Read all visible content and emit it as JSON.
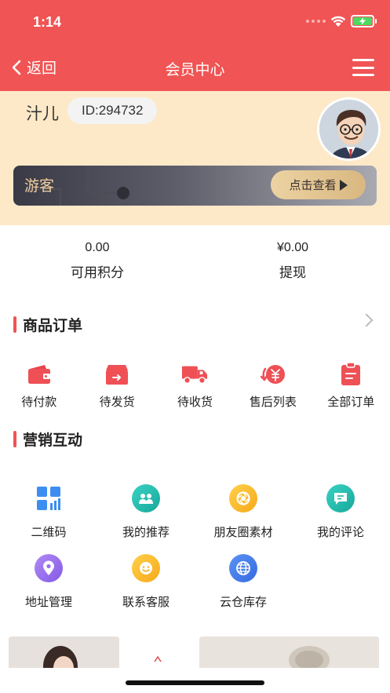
{
  "status": {
    "time": "1:14"
  },
  "nav": {
    "back_label": "返回",
    "title": "会员中心"
  },
  "profile": {
    "name": "汁儿",
    "id": "ID:294732"
  },
  "vip": {
    "level": "游客",
    "button": "点击查看"
  },
  "stats": [
    {
      "value": "0.00",
      "label": "可用积分"
    },
    {
      "value": "¥0.00",
      "label": "提现"
    }
  ],
  "orders": {
    "title": "商品订单",
    "items": [
      {
        "label": "待付款",
        "icon": "wallet-icon"
      },
      {
        "label": "待发货",
        "icon": "box-icon"
      },
      {
        "label": "待收货",
        "icon": "truck-icon"
      },
      {
        "label": "售后列表",
        "icon": "refund-icon"
      },
      {
        "label": "全部订单",
        "icon": "clipboard-icon"
      }
    ]
  },
  "marketing": {
    "title": "营销互动",
    "items": [
      {
        "label": "二维码",
        "icon": "qr-grid-icon"
      },
      {
        "label": "我的推荐",
        "icon": "recommend-icon"
      },
      {
        "label": "朋友圈素材",
        "icon": "moments-icon"
      },
      {
        "label": "我的评论",
        "icon": "comment-icon"
      },
      {
        "label": "地址管理",
        "icon": "location-icon"
      },
      {
        "label": "联系客服",
        "icon": "service-icon"
      },
      {
        "label": "云仓库存",
        "icon": "warehouse-icon"
      }
    ]
  },
  "colors": {
    "brand": "#f05454",
    "profile_bg": "#fde9c8",
    "gold": "#e3c38e"
  }
}
